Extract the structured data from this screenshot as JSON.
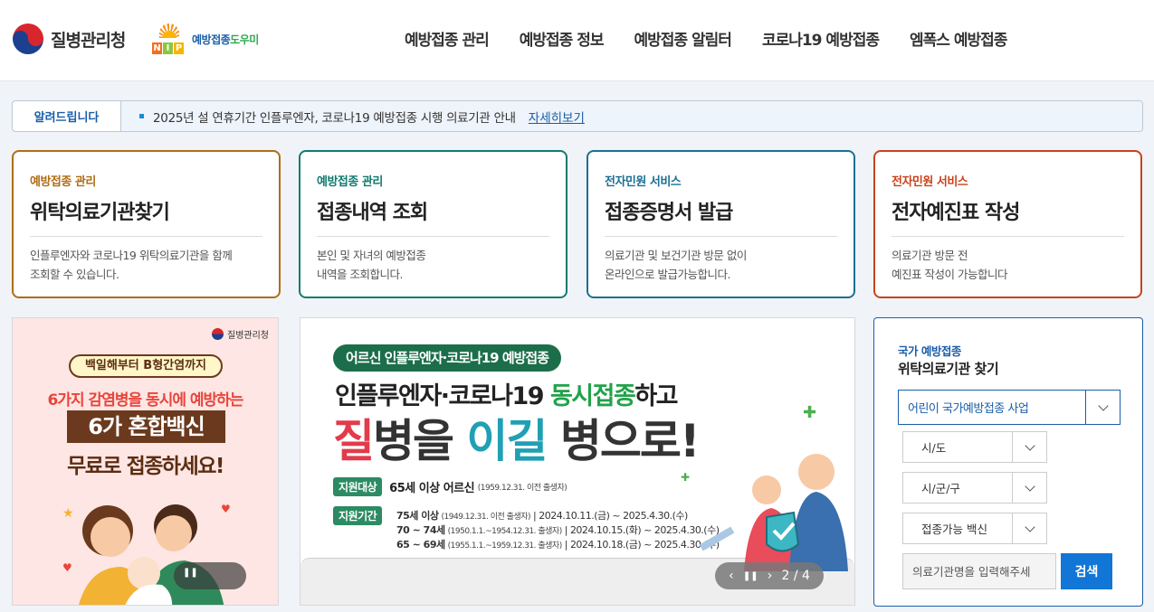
{
  "header": {
    "org_name": "질병관리청",
    "nip_text_main": "예방접종",
    "nip_text_accent": "도우미",
    "nip_letters": [
      "N",
      "I",
      "P"
    ],
    "nav": [
      "예방접종 관리",
      "예방접종 정보",
      "예방접종 알림터",
      "코로나19 예방접종",
      "엠폭스 예방접종"
    ]
  },
  "notice": {
    "label": "알려드립니다",
    "text": "2025년 설 연휴기간 인플루엔자, 코로나19 예방접종 시행 의료기관 안내",
    "link": "자세히보기"
  },
  "cards": [
    {
      "category": "예방접종 관리",
      "title": "위탁의료기관찾기",
      "desc": "인플루엔자와 코로나19 위탁의료기관을 함께\n조회할 수 있습니다.",
      "color": "#b06d15"
    },
    {
      "category": "예방접종 관리",
      "title": "접종내역 조회",
      "desc": "본인 및 자녀의 예방접종\n내역을 조회합니다.",
      "color": "#117a6f"
    },
    {
      "category": "전자민원 서비스",
      "title": "접종증명서 발급",
      "desc": "의료기관 및 보건기관 방문 없이\n온라인으로 발급가능합니다.",
      "color": "#1b6f93"
    },
    {
      "category": "전자민원 서비스",
      "title": "전자예진표 작성",
      "desc": "의료기관 방문 전\n예진표 작성이 가능합니다",
      "color": "#c8431c"
    }
  ],
  "banner_left": {
    "org": "질병관리청",
    "pill": "백일해부터 B형간염까지",
    "line1": "6가지 감염병을 동시에 예방하는",
    "line2": "6가 혼합백신",
    "line3": "무료로 접종하세요!"
  },
  "banner_center": {
    "tag": "어르신 인플루엔자·코로나19 예방접종",
    "head_prefix": "인플루엔자·코로나19 ",
    "head_accent": "동시접종",
    "head_suffix": "하고",
    "big_1": "질",
    "big_2": "병을 ",
    "big_3": "이길",
    "big_4": " 병으로!",
    "target_label": "지원대상",
    "target_text": "65세 이상 어르신",
    "target_note": "(1959.12.31. 이전 출생자)",
    "period_label": "지원기간",
    "schedule": [
      {
        "age": "75세 이상",
        "born": "(1949.12.31. 이전 출생자)",
        "range": "2024.10.11.(금) ~ 2025.4.30.(수)"
      },
      {
        "age": "70 ~ 74세",
        "born": "(1950.1.1.~1954.12.31. 출생자)",
        "range": "2024.10.15.(화) ~ 2025.4.30.(수)"
      },
      {
        "age": "65 ~ 69세",
        "born": "(1955.1.1.~1959.12.31. 출생자)",
        "range": "2024.10.18.(금) ~ 2025.4.30.(수)"
      }
    ],
    "pager": "2 / 4"
  },
  "search": {
    "subtitle": "국가 예방접종",
    "title": "위탁의료기관 찾기",
    "program_select": "어린이 국가예방접종 사업",
    "sido_select": "시/도",
    "sigungu_select": "시/군/구",
    "vaccine_select": "접종가능 백신",
    "input_placeholder": "의료기관명을 입력해주세",
    "search_button": "검색"
  }
}
